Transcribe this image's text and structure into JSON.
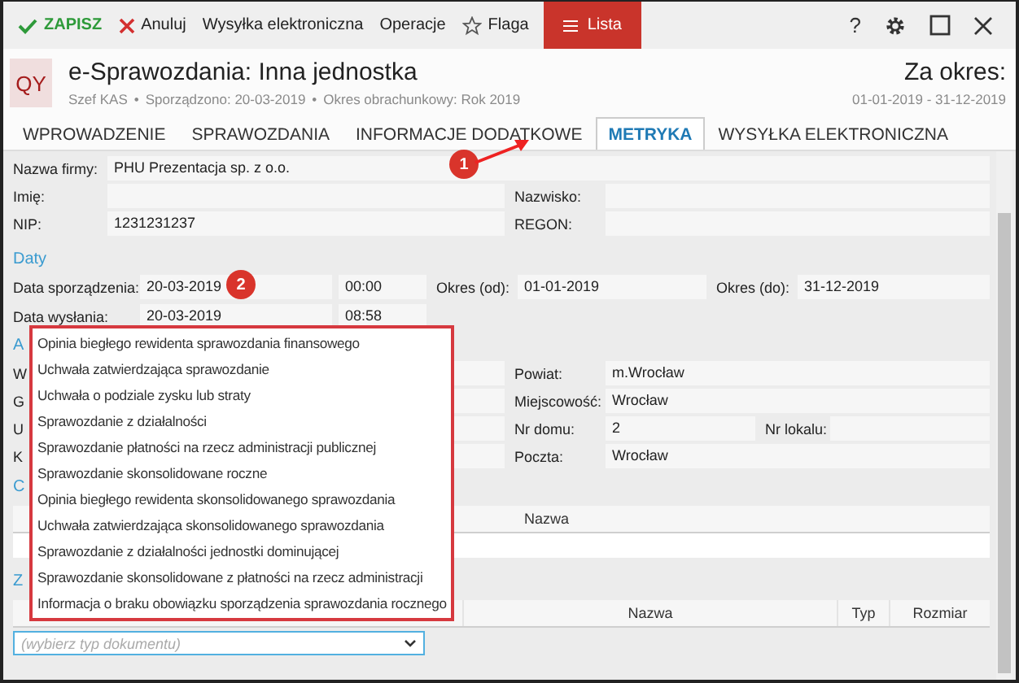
{
  "toolbar": {
    "buttons": [
      {
        "label": "ZAPISZ",
        "kind": "save"
      },
      {
        "label": "Anuluj",
        "kind": "cancel"
      },
      {
        "label": "Wysyłka elektroniczna",
        "kind": "text"
      },
      {
        "label": "Operacje",
        "kind": "text"
      },
      {
        "label": "Flaga",
        "kind": "flag"
      },
      {
        "label": "Lista",
        "kind": "list"
      }
    ],
    "help": "?"
  },
  "header": {
    "logo": "QY",
    "title": "e-Sprawozdania: Inna jednostka",
    "meta_separator": "•",
    "meta": [
      "Szef KAS",
      "Sporządzono: 20-03-2019",
      "Okres obrachunkowy: Rok 2019"
    ],
    "period_label": "Za okres:",
    "period": "01-01-2019 - 31-12-2019"
  },
  "tabs": [
    {
      "label": "WPROWADZENIE",
      "selected": false
    },
    {
      "label": "SPRAWOZDANIA",
      "selected": false
    },
    {
      "label": "INFORMACJE DODATKOWE",
      "selected": false
    },
    {
      "label": "METRYKA",
      "selected": true
    },
    {
      "label": "WYSYŁKA ELEKTRONICZNA",
      "selected": false
    }
  ],
  "company": {
    "name": {
      "label": "Nazwa firmy:",
      "value": "PHU Prezentacja sp. z o.o."
    },
    "first_name": {
      "label": "Imię:"
    },
    "last_name": {
      "label": "Nazwisko:"
    },
    "nip": {
      "label": "NIP:",
      "value": "1231231237"
    },
    "regon": {
      "label": "REGON:"
    }
  },
  "dates": {
    "heading": "Daty",
    "prepared": {
      "label": "Data sporządzenia:",
      "date": "20-03-2019",
      "time": "00:00"
    },
    "period_from": {
      "label": "Okres (od):",
      "value": "01-01-2019"
    },
    "period_to": {
      "label": "Okres (do):",
      "value": "31-12-2019"
    },
    "sent": {
      "label": "Data wysłania:",
      "date": "20-03-2019",
      "time": "08:58"
    }
  },
  "address": {
    "heading": "A",
    "left_labels": [
      "W",
      "G",
      "U",
      "K"
    ],
    "county": {
      "label": "Powiat:",
      "value": "m.Wrocław"
    },
    "city": {
      "label": "Miejscowość:",
      "value": "Wrocław"
    },
    "house_no": {
      "label": "Nr domu:",
      "value": "2"
    },
    "flat_no": {
      "label": "Nr lokalu:"
    },
    "post": {
      "label": "Poczta:",
      "value": "Wrocław"
    }
  },
  "table_1": {
    "heading": "C",
    "columns": [
      "Nazwa"
    ]
  },
  "table_2": {
    "heading": "Z",
    "columns": [
      "Nazwa",
      "Typ",
      "Rozmiar"
    ]
  },
  "document_type": {
    "placeholder": "(wybierz typ dokumentu)",
    "expanded": true,
    "options": [
      "Opinia biegłego rewidenta sprawozdania finansowego",
      "Uchwała zatwierdzająca sprawozdanie",
      "Uchwała o podziale zysku lub straty",
      "Sprawozdanie z działalności",
      "Sprawozdanie płatności na rzecz administracji publicznej",
      "Sprawozdanie skonsolidowane roczne",
      "Opinia biegłego rewidenta skonsolidowanego sprawozdania",
      "Uchwała zatwierdzająca skonsolidowanego sprawozdania",
      "Sprawozdanie z działalności jednostki dominującej",
      "Sprawozdanie skonsolidowane z płatności na rzecz administracji",
      "Informacja o braku obowiązku sporządzenia sprawozdania rocznego"
    ]
  },
  "callouts": [
    "1",
    "2"
  ]
}
